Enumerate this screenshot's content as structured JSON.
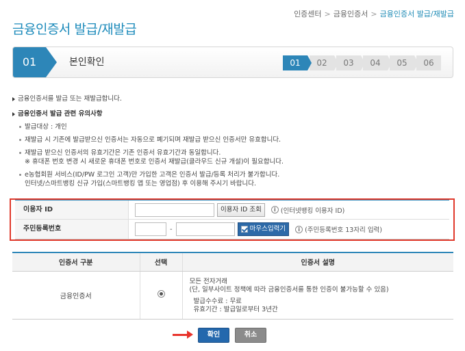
{
  "breadcrumb": {
    "items": [
      "인증센터",
      "금융인증서",
      "금융인증서 발급/재발급"
    ]
  },
  "page_title": "금융인증서 발급/재발급",
  "step_bar": {
    "current_number": "01",
    "current_label": "본인확인",
    "steps": [
      "01",
      "02",
      "03",
      "04",
      "05",
      "06"
    ],
    "active_step": "01"
  },
  "notices": {
    "intro": "금융인증서를 발급 또는 재발급합니다.",
    "caution_title": "금융인증서 발급 관련 유의사항",
    "items": [
      {
        "lines": [
          "발급대상 : 개인"
        ]
      },
      {
        "lines": [
          "재발급 시 기존에 발급받으신 인증서는 자동으로 폐기되며 재발급 받으신 인증서만 유효합니다."
        ]
      },
      {
        "lines": [
          "재발급 받으신 인증서의 유효기간은 기존 인증서 유효기간과 동일합니다.",
          "※ 휴대폰 번호 변경 시 새로운 휴대폰 번호로 인증서 재발급(클라우드 신규 개설)이 필요합니다."
        ]
      },
      {
        "lines": [
          "e농협회원 서비스(ID/PW 로그인 고객)만 가입한 고객은 인증서 발급/등록 처리가 불가합니다.",
          "인터넷/스마트뱅킹 신규 가입(스마트뱅킹 앱 또는 영업점) 후 이용해 주시기 바랍니다."
        ]
      }
    ]
  },
  "form": {
    "user_id_label": "이용자 ID",
    "user_id_value": "",
    "lookup_button": "이용자 ID 조회",
    "user_id_hint": "(인터넷뱅킹 이용자 ID)",
    "rrn_label": "주민등록번호",
    "rrn_front_value": "",
    "rrn_separator": "-",
    "rrn_back_value": "",
    "mouse_input_button": "마우스입력기",
    "mouse_input_checked": true,
    "rrn_hint": "(주민등록번호 13자리 입력)",
    "info_glyph": "i"
  },
  "cert_table": {
    "headers": [
      "인증서 구분",
      "선택",
      "인증서 설명"
    ],
    "row": {
      "type": "금융인증서",
      "selected": true,
      "description": {
        "line1": "모든 전자거래",
        "line2": "(단, 일부사이트 정책에 따라 금융인증서를 통한 인증이 불가능할 수 있음)",
        "fee": "발급수수료 : 무료",
        "validity": "유효기간 : 발급일로부터 3년간"
      }
    }
  },
  "actions": {
    "confirm": "확인",
    "cancel": "취소"
  },
  "colors": {
    "accent": "#2d86b8",
    "title": "#1d8bbb",
    "highlight_border": "#e0392b",
    "confirm_button": "#2468ad",
    "cancel_button": "#8b8b8b"
  }
}
